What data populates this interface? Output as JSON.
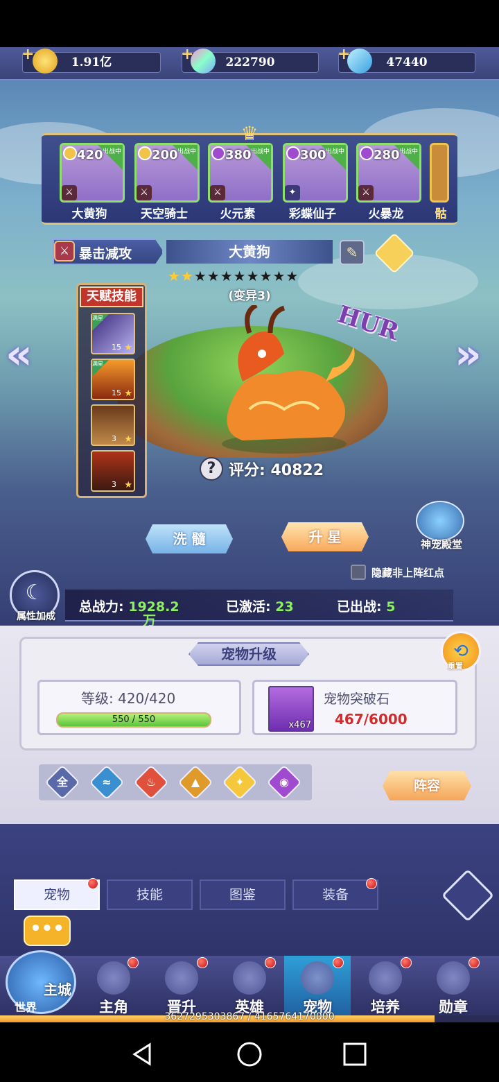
{
  "currencies": [
    {
      "value": "1.91亿",
      "icon": "gold-coin-icon",
      "color": "#f4c542"
    },
    {
      "value": "222790",
      "icon": "rainbow-diamond-icon",
      "color": "#c88cf0"
    },
    {
      "value": "47440",
      "icon": "blue-diamond-icon",
      "color": "#5ec8f2"
    }
  ],
  "pets": [
    {
      "level": "420",
      "name": "大黄狗",
      "status": "出战中"
    },
    {
      "level": "200",
      "name": "天空骑士",
      "status": "出战中"
    },
    {
      "level": "380",
      "name": "火元素",
      "status": "出战中"
    },
    {
      "level": "300",
      "name": "彩蝶仙子",
      "status": "出战中"
    },
    {
      "level": "280",
      "name": "火暴龙",
      "status": "出战中"
    },
    {
      "level": "",
      "name": "骷",
      "status": ""
    }
  ],
  "detail": {
    "skill_name": "暴击减攻",
    "pet_name": "大黄狗",
    "stars_lit": 2,
    "stars_total": 10,
    "variant": "(变异3)",
    "badge_text": "HUR",
    "score_label": "评分:",
    "score_value": "40822"
  },
  "talent": {
    "title": "天赋技能",
    "slots": [
      {
        "count": "15",
        "mark": "满星"
      },
      {
        "count": "15",
        "mark": "满星"
      },
      {
        "count": "3",
        "mark": ""
      },
      {
        "count": "3",
        "mark": ""
      }
    ]
  },
  "actions": {
    "wash": "洗 髓",
    "star_up": "升 星",
    "temple": "神宠殿堂",
    "hide_label": "隐藏非上阵红点"
  },
  "stats": {
    "attr_label": "属性加成",
    "total_label": "总战力:",
    "total_value": "1928.2",
    "total_unit": "万",
    "activated_label": "已激活:",
    "activated_value": "23",
    "deployed_label": "已出战:",
    "deployed_value": "5"
  },
  "upgrade": {
    "title": "宠物升级",
    "reset": "重置",
    "level_label": "等级:",
    "level_value": "420/420",
    "exp_text": "550 / 550",
    "exp_fraction": 1.0,
    "stone_name": "宠物突破石",
    "stone_count": "x467",
    "stone_progress": "467/6000"
  },
  "elements": [
    {
      "label": "全",
      "icon": "all-element-icon",
      "color": "#5a6aa8"
    },
    {
      "label": "",
      "icon": "water-element-icon",
      "color": "#3a8fd0"
    },
    {
      "label": "",
      "icon": "fire-element-icon",
      "color": "#e0503a"
    },
    {
      "label": "",
      "icon": "earth-element-icon",
      "color": "#e09a2a"
    },
    {
      "label": "",
      "icon": "light-element-icon",
      "color": "#f4c83a"
    },
    {
      "label": "",
      "icon": "shadow-element-icon",
      "color": "#a04ad0"
    }
  ],
  "lineup": "阵容",
  "tabs": [
    {
      "label": "宠物",
      "active": true,
      "dot": true
    },
    {
      "label": "技能",
      "active": false,
      "dot": false
    },
    {
      "label": "图鉴",
      "active": false,
      "dot": false
    },
    {
      "label": "装备",
      "active": false,
      "dot": true
    }
  ],
  "nav": {
    "city": "主城",
    "world": "世界",
    "items": [
      {
        "label": "主角",
        "icon": "hero-icon"
      },
      {
        "label": "晋升",
        "icon": "promote-icon"
      },
      {
        "label": "英雄",
        "icon": "helmet-icon"
      },
      {
        "label": "宠物",
        "icon": "pet-icon"
      },
      {
        "label": "培养",
        "icon": "train-icon"
      },
      {
        "label": "勋章",
        "icon": "medal-icon"
      }
    ]
  },
  "progress": {
    "text": "3627295303867 / 4165764170000",
    "fraction": 0.871
  }
}
